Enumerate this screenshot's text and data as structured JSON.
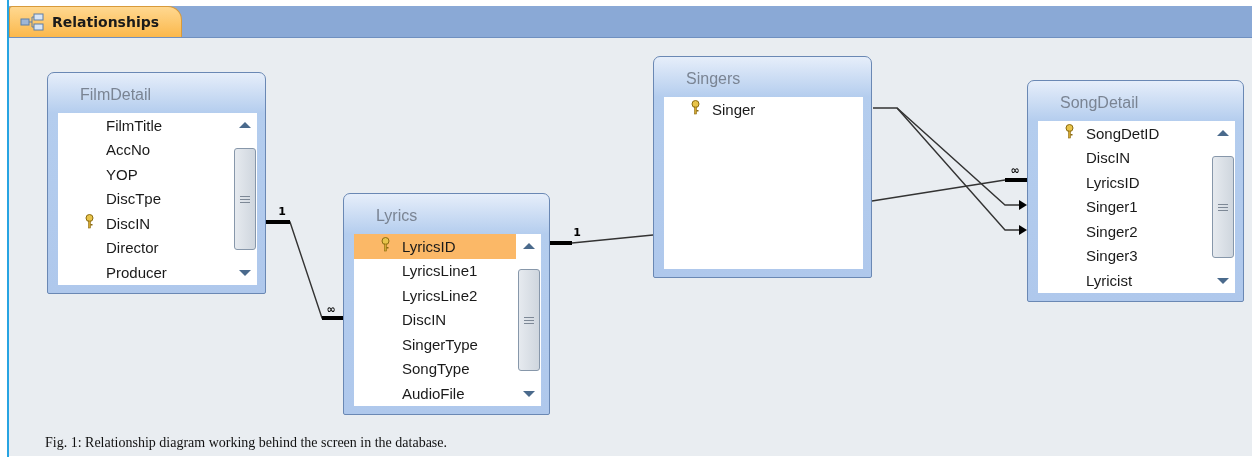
{
  "tab": {
    "label": "Relationships"
  },
  "tables": [
    {
      "title": "FilmDetail",
      "scrollbar": true,
      "fields": [
        {
          "name": "FilmTitle",
          "key": false,
          "selected": false
        },
        {
          "name": "AccNo",
          "key": false,
          "selected": false
        },
        {
          "name": "YOP",
          "key": false,
          "selected": false
        },
        {
          "name": "DiscTpe",
          "key": false,
          "selected": false
        },
        {
          "name": "DiscIN",
          "key": true,
          "selected": false
        },
        {
          "name": "Director",
          "key": false,
          "selected": false
        },
        {
          "name": "Producer",
          "key": false,
          "selected": false
        }
      ]
    },
    {
      "title": "Lyrics",
      "scrollbar": true,
      "fields": [
        {
          "name": "LyricsID",
          "key": true,
          "selected": true
        },
        {
          "name": "LyricsLine1",
          "key": false,
          "selected": false
        },
        {
          "name": "LyricsLine2",
          "key": false,
          "selected": false
        },
        {
          "name": "DiscIN",
          "key": false,
          "selected": false
        },
        {
          "name": "SingerType",
          "key": false,
          "selected": false
        },
        {
          "name": "SongType",
          "key": false,
          "selected": false
        },
        {
          "name": "AudioFile",
          "key": false,
          "selected": false
        }
      ]
    },
    {
      "title": "Singers",
      "scrollbar": false,
      "fields": [
        {
          "name": "Singer",
          "key": true,
          "selected": false
        }
      ]
    },
    {
      "title": "SongDetail",
      "scrollbar": true,
      "fields": [
        {
          "name": "SongDetID",
          "key": true,
          "selected": false
        },
        {
          "name": "DiscIN",
          "key": false,
          "selected": false
        },
        {
          "name": "LyricsID",
          "key": false,
          "selected": false
        },
        {
          "name": "Singer1",
          "key": false,
          "selected": false
        },
        {
          "name": "Singer2",
          "key": false,
          "selected": false
        },
        {
          "name": "Singer3",
          "key": false,
          "selected": false
        },
        {
          "name": "Lyricist",
          "key": false,
          "selected": false
        }
      ]
    }
  ],
  "relationships": [
    {
      "kind": "enforced",
      "labels": [
        "1",
        "∞"
      ]
    },
    {
      "kind": "enforced",
      "labels": [
        "1"
      ]
    },
    {
      "kind": "enforced",
      "labels": [
        "∞"
      ]
    },
    {
      "kind": "outer-join"
    },
    {
      "kind": "outer-join"
    }
  ],
  "caption": "Fig. 1: Relationship diagram working behind the screen in the database."
}
